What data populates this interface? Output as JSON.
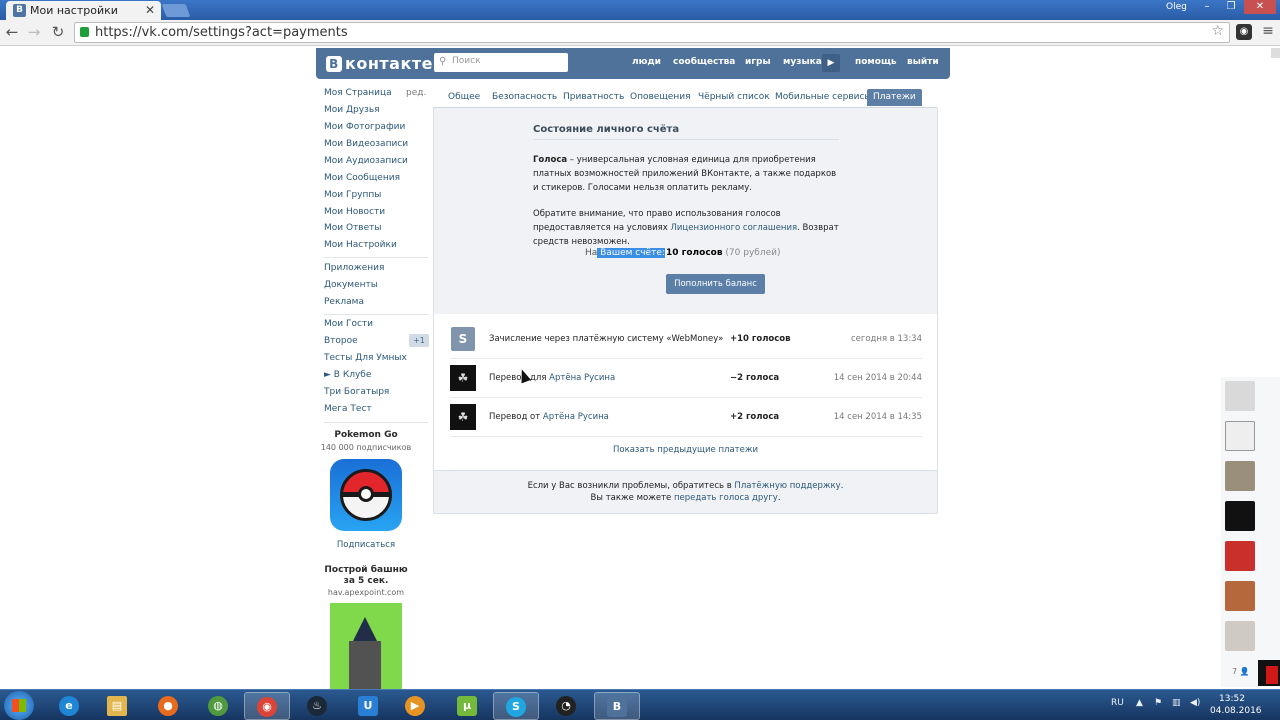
{
  "browser": {
    "tab_title": "Мои настройки",
    "tab_favicon": "B",
    "close_tab": "✕",
    "user": "Oleg",
    "url": "https://vk.com/settings?act=payments"
  },
  "vk": {
    "logo": "контакте",
    "logo_letter": "В",
    "search_placeholder": "Поиск",
    "nav": [
      "люди",
      "сообщества",
      "игры",
      "музыка",
      "помощь",
      "выйти"
    ]
  },
  "left_menu": {
    "edit_label": "ред.",
    "items": [
      "Моя Страница",
      "Мои Друзья",
      "Мои Фотографии",
      "Мои Видеозаписи",
      "Мои Аудиозаписи",
      "Мои Сообщения",
      "Мои Группы",
      "Мои Новости",
      "Мои Ответы",
      "Мои Настройки"
    ],
    "items2": [
      "Приложения",
      "Документы",
      "Реклама"
    ],
    "items3": [
      "Мои Гости",
      "Второе",
      "Тесты Для Умных",
      "► В Клубе",
      "Три Богатыря",
      "Мега Тест"
    ],
    "badge": "+1"
  },
  "promo": {
    "p1_title": "Pokemon Go",
    "p1_sub": "140 000 подписчиков",
    "p1_action": "Подписаться",
    "p2_title": "Построй башню за 5 сек.",
    "p2_sub": "hav.apexpoint.com"
  },
  "settings_tabs": [
    "Общее",
    "Безопасность",
    "Приватность",
    "Оповещения",
    "Чёрный список",
    "Мобильные сервисы",
    "Платежи"
  ],
  "balance": {
    "title": "Состояние личного счёта",
    "p1_bold": "Голоса",
    "p1_rest": " – универсальная условная единица для приобретения платных возможностей приложений ВКонтакте, а также подарков и стикеров. Голосами нельзя оплатить рекламу.",
    "p2_a": "Обратите внимание, что право использования голосов предоставляется на условиях ",
    "p2_link": "Лицензионного соглашения",
    "p2_b": ". Возврат средств невозможен.",
    "on_account_prefix": "На",
    "on_account_hl": " Вашем счёте:",
    "amount": "10 голосов",
    "amount_rub": "(70 рублей)",
    "button": "Пополнить баланс"
  },
  "transactions": [
    {
      "icon": "S",
      "text": "Зачисление через платёжную систему «WebMoney»",
      "link": "",
      "amount": "+10 голосов",
      "date": "сегодня в 13:34"
    },
    {
      "icon": "☘",
      "text": "Перевод для ",
      "link": "Артёна Русина",
      "amount": "−2 голоса",
      "date": "14 сен 2014 в 20:44"
    },
    {
      "icon": "☘",
      "text": "Перевод от ",
      "link": "Артёна Русина",
      "amount": "+2 голоса",
      "date": "14 сен 2014 в 14:35"
    }
  ],
  "show_prev": "Показать предыдущие платежи",
  "footer": {
    "line1_a": "Если у Вас возникли проблемы, обратитесь в ",
    "line1_link": "Платёжную поддержку",
    "line1_b": ".",
    "line2_a": "Вы также можете ",
    "line2_link": "передать голоса другу",
    "line2_b": "."
  },
  "friends_count": "7 👤",
  "taskbar": {
    "lang": "RU",
    "time": "13:52",
    "date": "04.08.2016"
  },
  "colors": {
    "vk_blue": "#4e729a",
    "link": "#2b587a",
    "panel_bg": "#f0f2f5"
  }
}
